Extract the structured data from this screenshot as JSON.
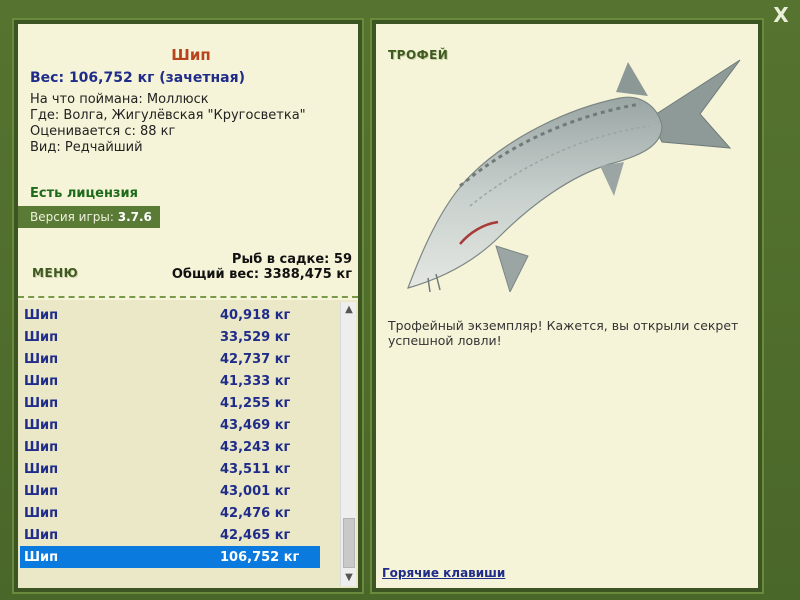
{
  "close_label": "X",
  "fish": {
    "name": "Шип",
    "weight_line": "Вес: 106,752 кг (зачетная)",
    "bait": "На что поймана: Моллюск",
    "location": "Где: Волга, Жигулёвская \"Кругосветка\"",
    "valued_from": "Оценивается с: 88 кг",
    "kind": "Вид: Редчайший"
  },
  "license_text": "Есть лицензия",
  "version": {
    "label": "Версия игры:",
    "value": "3.7.6"
  },
  "menu_title": "МЕНЮ",
  "keep": {
    "count_text": "Рыб в садке: 59",
    "total_text": "Общий вес: 3388,475 кг"
  },
  "catch_list": [
    {
      "name": "Шип",
      "weight": "40,918 кг"
    },
    {
      "name": "Шип",
      "weight": "33,529 кг"
    },
    {
      "name": "Шип",
      "weight": "42,737 кг"
    },
    {
      "name": "Шип",
      "weight": "41,333 кг"
    },
    {
      "name": "Шип",
      "weight": "41,255 кг"
    },
    {
      "name": "Шип",
      "weight": "43,469 кг"
    },
    {
      "name": "Шип",
      "weight": "43,243 кг"
    },
    {
      "name": "Шип",
      "weight": "43,511 кг"
    },
    {
      "name": "Шип",
      "weight": "43,001 кг"
    },
    {
      "name": "Шип",
      "weight": "42,476 кг"
    },
    {
      "name": "Шип",
      "weight": "42,465 кг"
    },
    {
      "name": "Шип",
      "weight": "106,752 кг"
    }
  ],
  "selected_index": 11,
  "trophy": {
    "title": "ТРОФЕЙ",
    "text": "Трофейный экземпляр! Кажется, вы открыли секрет успешной ловли!"
  },
  "hotkeys_label": "Горячие клавиши",
  "colors": {
    "frame": "#4d6b2c",
    "panel": "#f6f4d8",
    "accent_title": "#b8431d",
    "link_blue": "#1f2c8a",
    "selection": "#0a7adf",
    "license_green": "#1d6b1a"
  }
}
